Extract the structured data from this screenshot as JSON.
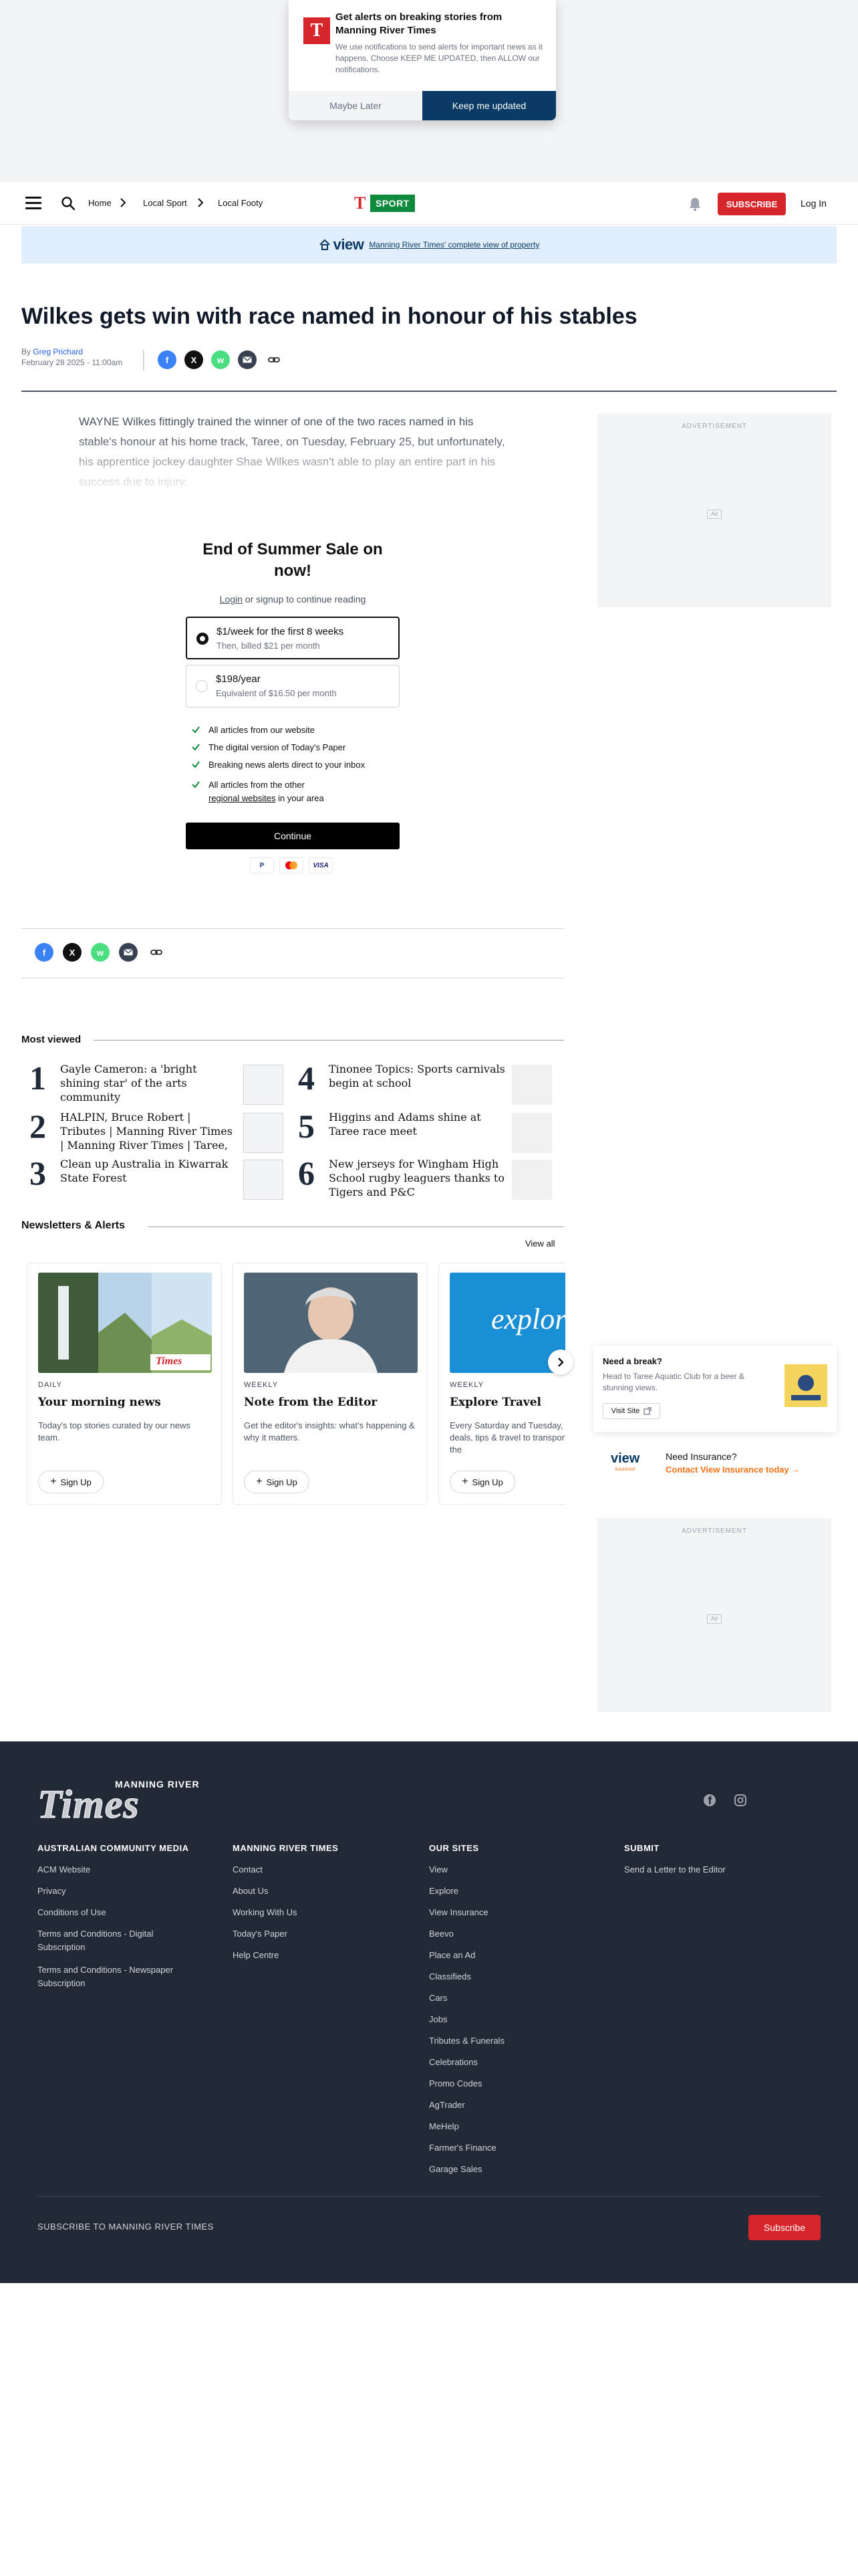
{
  "notification": {
    "title": "Get alerts on breaking stories from Manning River Times",
    "body": "We use notifications to send alerts for important news as it happens. Choose KEEP ME UPDATED, then ALLOW our notifications.",
    "maybe_label": "Maybe Later",
    "keep_label": "Keep me updated",
    "logo_letter": "T"
  },
  "header": {
    "breadcrumbs": [
      "Home",
      "Local Sport",
      "Local Footy"
    ],
    "brand_letter": "T",
    "brand_section": "SPORT",
    "subscribe_label": "SUBSCRIBE",
    "login_label": "Log In"
  },
  "view_banner": {
    "logo": "view",
    "text": "Manning River Times' complete view of property"
  },
  "article": {
    "headline": "Wilkes gets win with race named in honour of his stables",
    "byline_prefix": "By ",
    "author": "Greg Prichard",
    "date": "February 28 2025 - 11:00am",
    "lead": "WAYNE Wilkes fittingly trained the winner of one of the two races named in his stable's honour at his home track, Taree, on Tuesday, February 25, but unfortunately, his apprentice jockey daughter Shae Wilkes wasn't able to play an entire part in his success due to injury."
  },
  "ads": {
    "label": "ADVERTISEMENT",
    "badge": "Ad"
  },
  "paywall": {
    "title": "End of Summer Sale on now!",
    "login_link": "Login",
    "login_rest": " or signup to continue reading",
    "plans": [
      {
        "title": "$1/week for the first 8 weeks",
        "subtitle": "Then, billed $21 per month",
        "selected": true
      },
      {
        "title": "$198/year",
        "subtitle": "Equivalent of $16.50 per month",
        "selected": false
      }
    ],
    "benefits": [
      "All articles from our website",
      "The digital version of Today's Paper",
      "Breaking news alerts direct to your inbox",
      "All articles from the other"
    ],
    "benefit_link": "regional websites",
    "benefit_suffix": " in your area",
    "continue_label": "Continue",
    "payment_methods": [
      "P",
      "MC",
      "VISA"
    ]
  },
  "most_viewed": {
    "title": "Most viewed",
    "items": [
      {
        "num": "1",
        "title": "Gayle Cameron: a 'bright shining star' of the arts community"
      },
      {
        "num": "2",
        "title": "HALPIN, Bruce Robert | Tributes | Manning River Times | Manning River Times | Taree,"
      },
      {
        "num": "3",
        "title": "Clean up Australia in Kiwarrak State Forest"
      },
      {
        "num": "4",
        "title": "Tinonee Topics: Sports carnivals begin at school"
      },
      {
        "num": "5",
        "title": "Higgins and Adams shine at Taree race meet"
      },
      {
        "num": "6",
        "title": "New jerseys for Wingham High School rugby leaguers thanks to Tigers and P&C"
      }
    ]
  },
  "newsletters": {
    "title": "Newsletters & Alerts",
    "view_all": "View all",
    "signup_label": "Sign Up",
    "items": [
      {
        "freq": "DAILY",
        "title": "Your morning news",
        "desc": "Today's top stories curated by our news team."
      },
      {
        "freq": "WEEKLY",
        "title": "Note from the Editor",
        "desc": "Get the editor's insights: what's happening & why it matters."
      },
      {
        "freq": "WEEKLY",
        "title": "Explore Travel",
        "desc": "Every Saturday and Tuesday, destinations deals, tips & travel to transport you around the"
      }
    ],
    "explore_word": "explore",
    "times_badge": "Times"
  },
  "promos": {
    "break_title": "Need a break?",
    "break_body": "Head to Taree Aquatic Club for a beer & stunning views.",
    "visit_label": "Visit Site",
    "ins_logo": "view",
    "ins_sub": "insurance",
    "ins_title": "Need Insurance?",
    "ins_link": "Contact View Insurance today"
  },
  "footer": {
    "logo_small": "MANNING RIVER",
    "logo_big": "Times",
    "columns": [
      {
        "heading": "AUSTRALIAN COMMUNITY MEDIA",
        "links": [
          "ACM Website",
          "Privacy",
          "Conditions of Use",
          "Terms and Conditions - Digital Subscription",
          "Terms and Conditions - Newspaper Subscription"
        ]
      },
      {
        "heading": "MANNING RIVER TIMES",
        "links": [
          "Contact",
          "About Us",
          "Working With Us",
          "Today's Paper",
          "Help Centre"
        ]
      },
      {
        "heading": "OUR SITES",
        "links": [
          "View",
          "Explore",
          "View Insurance",
          "Beevo",
          "Place an Ad",
          "Classifieds",
          "Cars",
          "Jobs",
          "Tributes & Funerals",
          "Celebrations",
          "Promo Codes",
          "AgTrader",
          "MeHelp",
          "Farmer's Finance",
          "Garage Sales"
        ]
      },
      {
        "heading": "SUBMIT",
        "links": [
          "Send a Letter to the Editor"
        ]
      }
    ],
    "subscribe_text": "SUBSCRIBE TO MANNING RIVER TIMES",
    "subscribe_button": "Subscribe"
  },
  "colors": {
    "brand_red": "#d6262c",
    "sport_green": "#0f8a3c",
    "navy": "#0a3a66",
    "footer_bg": "#212936"
  }
}
